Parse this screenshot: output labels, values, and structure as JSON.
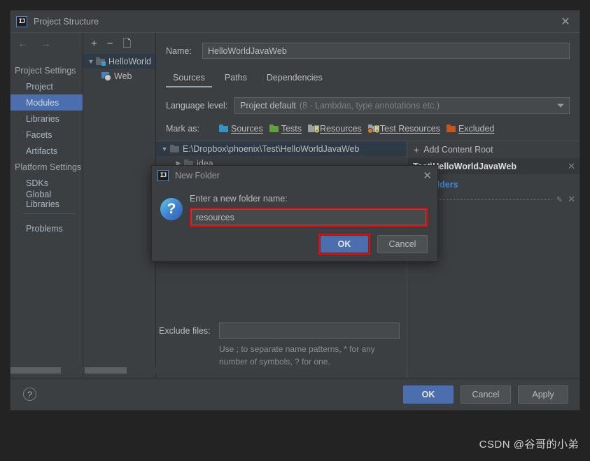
{
  "window": {
    "title": "Project Structure",
    "logo_icon": "intellij-idea-logo",
    "close_icon": "close-icon"
  },
  "nav": {
    "back_icon": "arrow-left-icon",
    "forward_icon": "arrow-right-icon"
  },
  "sidebar": {
    "groups": [
      {
        "label": "Project Settings",
        "items": [
          {
            "label": "Project",
            "selected": false
          },
          {
            "label": "Modules",
            "selected": true
          },
          {
            "label": "Libraries",
            "selected": false
          },
          {
            "label": "Facets",
            "selected": false
          },
          {
            "label": "Artifacts",
            "selected": false
          }
        ]
      },
      {
        "label": "Platform Settings",
        "items": [
          {
            "label": "SDKs",
            "selected": false
          },
          {
            "label": "Global Libraries",
            "selected": false
          }
        ]
      }
    ],
    "problems_label": "Problems"
  },
  "tree_toolbar": {
    "add_icon": "plus-icon",
    "remove_icon": "minus-icon",
    "copy_icon": "copy-icon"
  },
  "module_tree": {
    "nodes": [
      {
        "label": "HelloWorld",
        "icon": "module-folder-icon",
        "expanded": true,
        "selected": true,
        "depth": 0
      },
      {
        "label": "Web",
        "icon": "web-facet-icon",
        "expanded": false,
        "selected": false,
        "depth": 1
      }
    ]
  },
  "main": {
    "name_label": "Name:",
    "name_value": "HelloWorldJavaWeb",
    "tabs": [
      {
        "label": "Sources",
        "active": true
      },
      {
        "label": "Paths",
        "active": false
      },
      {
        "label": "Dependencies",
        "active": false
      }
    ],
    "language_level_label": "Language level:",
    "language_level_value": "Project default",
    "language_level_hint": "(8 - Lambdas, type annotations etc.)",
    "dropdown_icon": "chevron-down-icon",
    "mark_as_label": "Mark as:",
    "mark_as_options": [
      {
        "label": "Sources",
        "color": "#3592c4",
        "icon": "folder-sources-icon"
      },
      {
        "label": "Tests",
        "color": "#62a03c",
        "icon": "folder-tests-icon"
      },
      {
        "label": "Resources",
        "color": "#9aa0a3",
        "icon": "folder-resources-icon"
      },
      {
        "label": "Test Resources",
        "color": "#9aa0a3",
        "icon": "folder-test-resources-icon"
      },
      {
        "label": "Excluded",
        "color": "#c4561e",
        "icon": "folder-excluded-icon"
      }
    ],
    "content_tree": [
      {
        "label": "E:\\Dropbox\\phoenix\\Test\\HelloWorldJavaWeb",
        "depth": 0,
        "expanded": true,
        "selected": true
      },
      {
        "label": "idea",
        "depth": 1,
        "expanded": false,
        "selected": false
      }
    ],
    "exclude_files_label": "Exclude files:",
    "exclude_files_value": "",
    "exclude_hint": "Use ; to separate name patterns, * for any number of symbols, ? for one."
  },
  "roots_panel": {
    "add_content_root_label": "Add Content Root",
    "add_icon": "plus-icon",
    "root_path": "Test\\HelloWorldJavaWeb",
    "root_close_icon": "close-icon",
    "source_folders_title": "ce Folders",
    "entry_edit_icon": "pencil-icon",
    "entry_close_icon": "close-icon"
  },
  "footer": {
    "help_icon": "question-mark-icon",
    "help_label": "?",
    "buttons": [
      {
        "label": "OK",
        "primary": true
      },
      {
        "label": "Cancel",
        "primary": false
      },
      {
        "label": "Apply",
        "primary": false
      }
    ]
  },
  "new_folder_dialog": {
    "logo_icon": "intellij-idea-logo",
    "title": "New Folder",
    "close_icon": "close-icon",
    "question_icon": "question-mark-icon",
    "question_glyph": "?",
    "prompt": "Enter a new folder name:",
    "input_value": "resources",
    "input_placeholder": "",
    "ok_label": "OK",
    "cancel_label": "Cancel",
    "highlight_color": "#ff0000"
  },
  "watermark": {
    "text": "CSDN @谷哥的小弟"
  }
}
